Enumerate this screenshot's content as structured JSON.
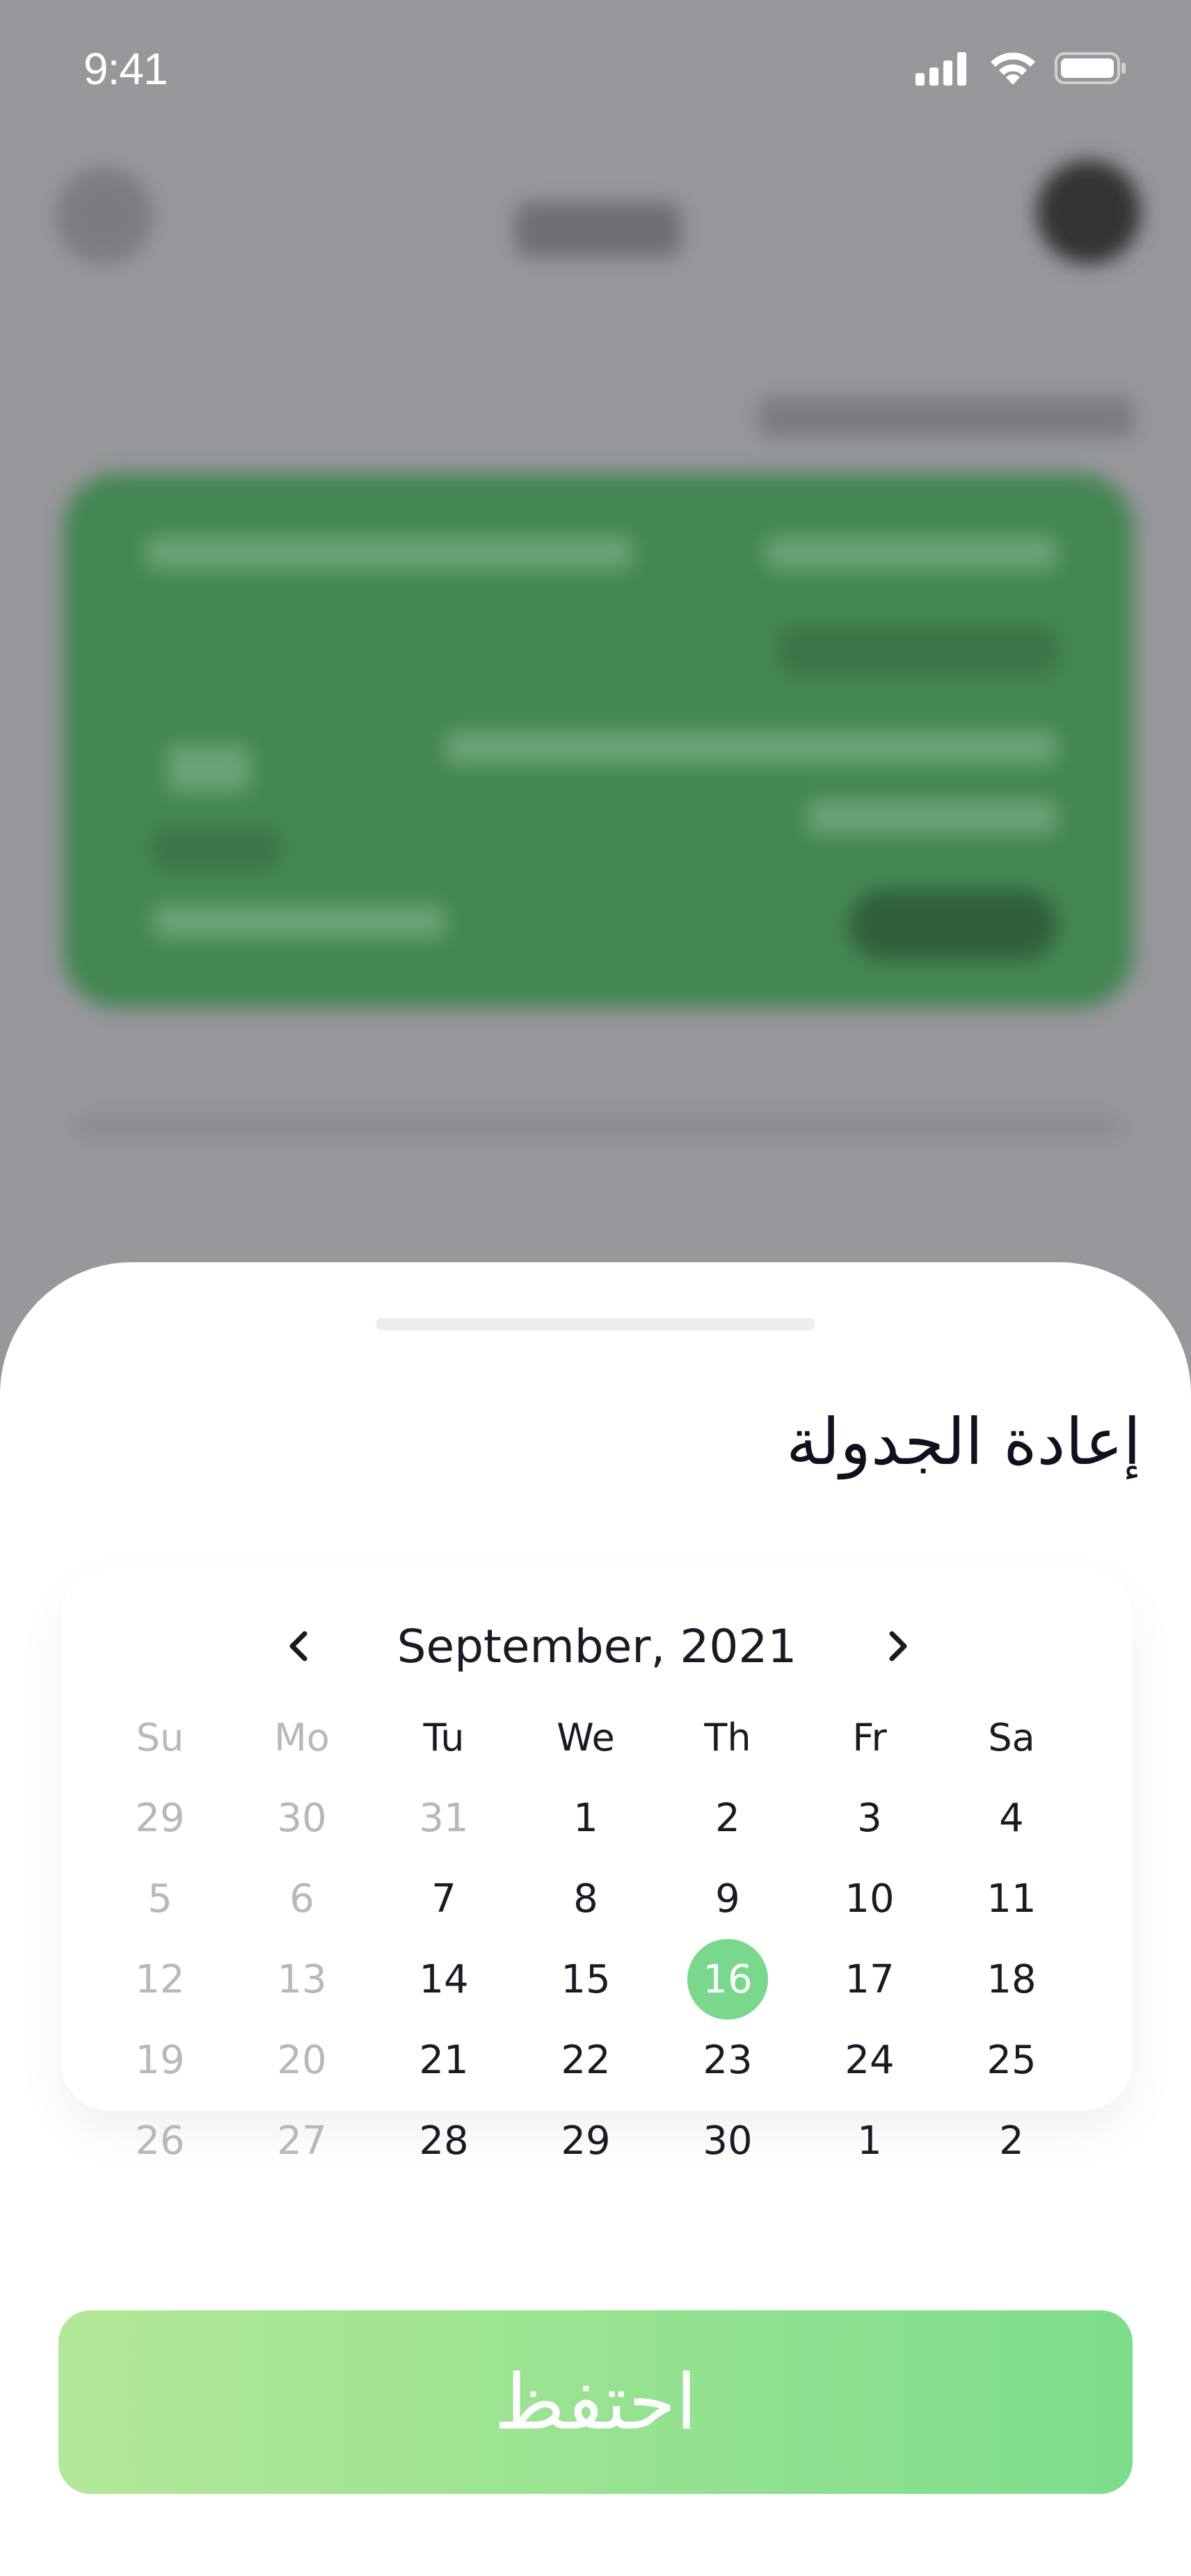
{
  "status_bar": {
    "time": "9:41",
    "icons": [
      "cellular-signal-icon",
      "wifi-icon",
      "battery-icon"
    ]
  },
  "sheet": {
    "title": "إعادة الجدولة"
  },
  "calendar": {
    "month_label": "September, 2021",
    "prev_icon": "chevron-left-icon",
    "next_icon": "chevron-right-icon",
    "weekdays": [
      "Su",
      "Mo",
      "Tu",
      "We",
      "Th",
      "Fr",
      "Sa"
    ],
    "weeks": [
      [
        "29",
        "30",
        "31",
        "1",
        "2",
        "3",
        "4"
      ],
      [
        "5",
        "6",
        "7",
        "8",
        "9",
        "10",
        "11"
      ],
      [
        "12",
        "13",
        "14",
        "15",
        "16",
        "17",
        "18"
      ],
      [
        "19",
        "20",
        "21",
        "22",
        "23",
        "24",
        "25"
      ],
      [
        "26",
        "27",
        "28",
        "29",
        "30",
        "1",
        "2"
      ]
    ],
    "selected_day": "16",
    "accent_color": "#7ad88c"
  },
  "actions": {
    "save_label": "احتفظ",
    "gradient_from": "#b3e898",
    "gradient_to": "#7ddd8b"
  }
}
